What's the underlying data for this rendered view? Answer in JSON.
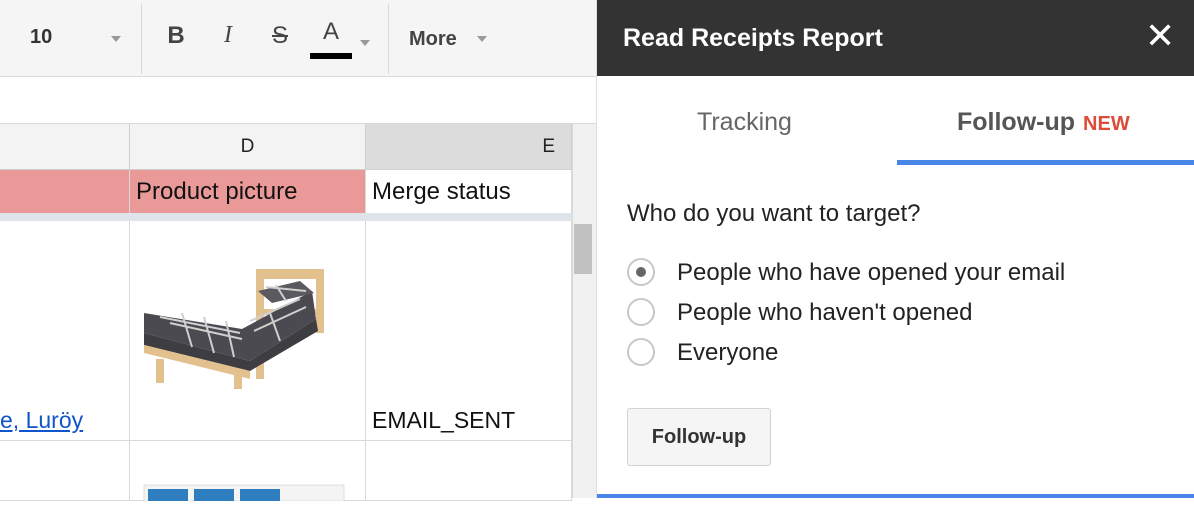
{
  "toolbar": {
    "font_size": "10",
    "bold_label": "B",
    "italic_label": "I",
    "strike_label": "S",
    "text_color_label": "A",
    "more_label": "More"
  },
  "sheet": {
    "columns": [
      "D",
      "E"
    ],
    "header_row": {
      "product_picture": "Product picture",
      "merge_status": "Merge status"
    },
    "rows": [
      {
        "name_fragment": "e, Luröy",
        "merge_status": "EMAIL_SENT"
      }
    ]
  },
  "sidebar": {
    "title": "Read Receipts Report",
    "close_glyph": "✕",
    "tabs": [
      {
        "label": "Tracking"
      },
      {
        "label": "Follow-up",
        "badge": "NEW"
      }
    ],
    "question": "Who do you want to target?",
    "options": [
      {
        "label": "People who have opened your email",
        "checked": true
      },
      {
        "label": "People who haven't opened",
        "checked": false
      },
      {
        "label": "Everyone",
        "checked": false
      }
    ],
    "button_label": "Follow-up"
  },
  "colors": {
    "header_bg": "#333333",
    "tab_underline": "#4a86e8",
    "header_row_bg": "#ea9999",
    "badge": "#dd4b39",
    "link": "#1155cc"
  }
}
